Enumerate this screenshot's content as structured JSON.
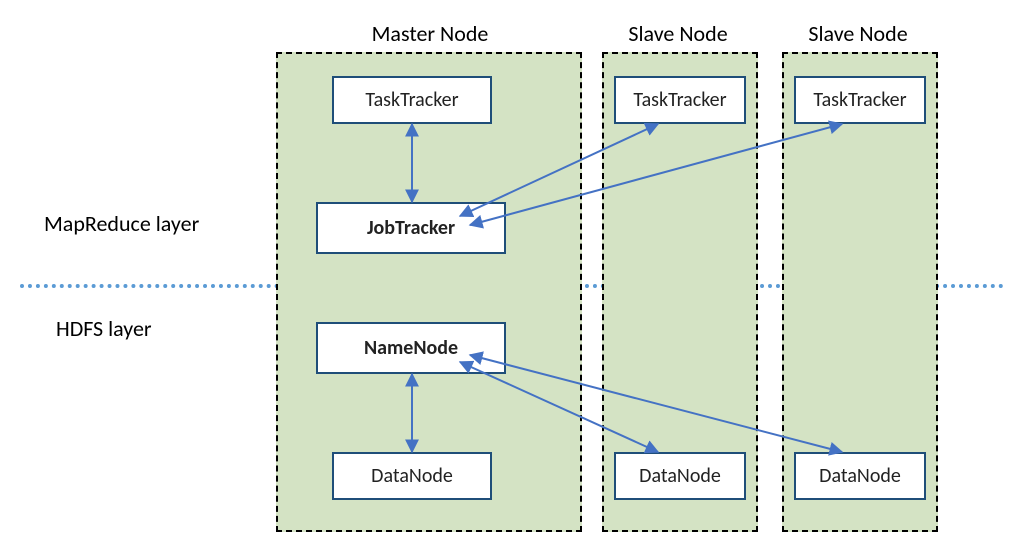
{
  "layers": {
    "mapreduce": "MapReduce layer",
    "hdfs": "HDFS layer"
  },
  "nodes": {
    "master": {
      "title": "Master Node",
      "components": {
        "tasktracker": "TaskTracker",
        "jobtracker": "JobTracker",
        "namenode": "NameNode",
        "datanode": "DataNode"
      }
    },
    "slave1": {
      "title": "Slave Node",
      "components": {
        "tasktracker": "TaskTracker",
        "datanode": "DataNode"
      }
    },
    "slave2": {
      "title": "Slave Node",
      "components": {
        "tasktracker": "TaskTracker",
        "datanode": "DataNode"
      }
    }
  },
  "connections": [
    {
      "from": "master.jobtracker",
      "to": "master.tasktracker",
      "bidirectional": true
    },
    {
      "from": "master.jobtracker",
      "to": "slave1.tasktracker",
      "bidirectional": true
    },
    {
      "from": "master.jobtracker",
      "to": "slave2.tasktracker",
      "bidirectional": true
    },
    {
      "from": "master.namenode",
      "to": "master.datanode",
      "bidirectional": true
    },
    {
      "from": "master.namenode",
      "to": "slave1.datanode",
      "bidirectional": true
    },
    {
      "from": "master.namenode",
      "to": "slave2.datanode",
      "bidirectional": true
    }
  ]
}
